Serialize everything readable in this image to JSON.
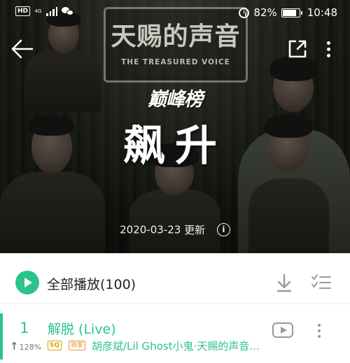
{
  "status_bar": {
    "hd_label": "HD",
    "network_type": "4G",
    "battery_percent": "82%",
    "battery_level": 0.82,
    "time": "10:48"
  },
  "hero": {
    "show_title_cn": "天赐的声音",
    "show_title_en": "THE TREASURED VOICE",
    "chart_logo": "巅峰榜",
    "chart_name": "飙升",
    "update_date": "2020-03-23",
    "update_label": "更新",
    "info_icon_glyph": "i"
  },
  "play_all": {
    "label": "全部播放(100)"
  },
  "songs": [
    {
      "rank": "1",
      "title": "解脱 (Live)",
      "trend_percent": "128%",
      "trend_arrow": "↑",
      "quality_badge": "SQ",
      "exclusive_badge": "独家",
      "artists": "胡彦斌/Lil Ghost小鬼·天赐的声音..."
    }
  ],
  "colors": {
    "accent": "#2cc38b",
    "sq_badge": "#e0a400",
    "exclusive_badge": "#e8913a"
  },
  "icons": [
    "back-arrow-icon",
    "share-icon",
    "more-vertical-icon",
    "play-icon",
    "download-icon",
    "multi-select-icon",
    "mv-icon",
    "info-icon",
    "trend-up-icon"
  ]
}
